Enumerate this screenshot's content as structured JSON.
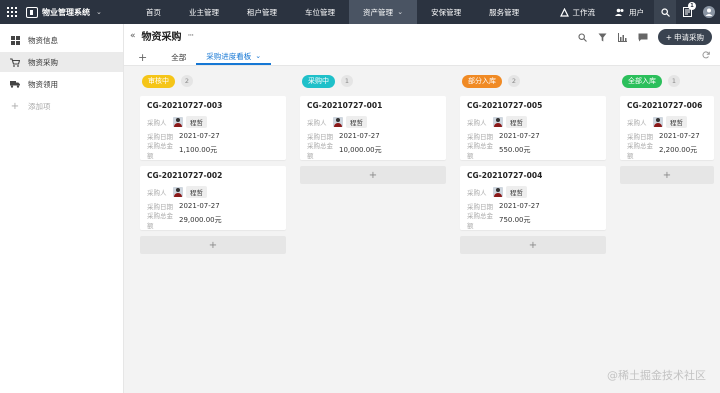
{
  "topbar": {
    "app_name": "物业管理系统",
    "nav": [
      "首页",
      "业主管理",
      "租户管理",
      "车位管理",
      "资产管理",
      "安保管理",
      "服务管理"
    ],
    "active_nav": 4,
    "workflow": "工作流",
    "user": "用户",
    "notification_count": "1"
  },
  "sidebar": {
    "items": [
      {
        "label": "物资信息",
        "icon": "grid-icon"
      },
      {
        "label": "物资采购",
        "icon": "cart-icon"
      },
      {
        "label": "物资领用",
        "icon": "truck-icon"
      }
    ],
    "add_label": "添加项",
    "active": 1
  },
  "header": {
    "title": "物资采购",
    "tabs": [
      "全部",
      "采购进度看板"
    ],
    "active_tab": 1,
    "new_button": "申请采购"
  },
  "board": {
    "colors": {
      "pending": "#f5c518",
      "buying": "#1fc0c9",
      "partial": "#f08a24",
      "done": "#2bbf5b"
    },
    "columns": [
      {
        "status": "审核中",
        "color": "#f5c518",
        "count": "2",
        "cards": [
          {
            "id": "CG-20210727-003",
            "buyer_label": "采购人",
            "buyer": "程哲",
            "date_label": "采购日期",
            "date": "2021-07-27",
            "amount_label": "采购总金额",
            "amount": "1,100.00元"
          },
          {
            "id": "CG-20210727-002",
            "buyer_label": "采购人",
            "buyer": "程哲",
            "date_label": "采购日期",
            "date": "2021-07-27",
            "amount_label": "采购总金额",
            "amount": "29,000.00元"
          }
        ]
      },
      {
        "status": "采购中",
        "color": "#1fc0c9",
        "count": "1",
        "cards": [
          {
            "id": "CG-20210727-001",
            "buyer_label": "采购人",
            "buyer": "程哲",
            "date_label": "采购日期",
            "date": "2021-07-27",
            "amount_label": "采购总金额",
            "amount": "10,000.00元"
          }
        ]
      },
      {
        "status": "部分入库",
        "color": "#f08a24",
        "count": "2",
        "cards": [
          {
            "id": "CG-20210727-005",
            "buyer_label": "采购人",
            "buyer": "程哲",
            "date_label": "采购日期",
            "date": "2021-07-27",
            "amount_label": "采购总金额",
            "amount": "550.00元"
          },
          {
            "id": "CG-20210727-004",
            "buyer_label": "采购人",
            "buyer": "程哲",
            "date_label": "采购日期",
            "date": "2021-07-27",
            "amount_label": "采购总金额",
            "amount": "750.00元"
          }
        ]
      },
      {
        "status": "全部入库",
        "color": "#2bbf5b",
        "count": "1",
        "cards": [
          {
            "id": "CG-20210727-006",
            "buyer_label": "采购人",
            "buyer": "程哲",
            "date_label": "采购日期",
            "date": "2021-07-27",
            "amount_label": "采购总金额",
            "amount": "2,200.00元"
          }
        ]
      }
    ],
    "add_symbol": "+"
  },
  "watermark": "@稀土掘金技术社区"
}
